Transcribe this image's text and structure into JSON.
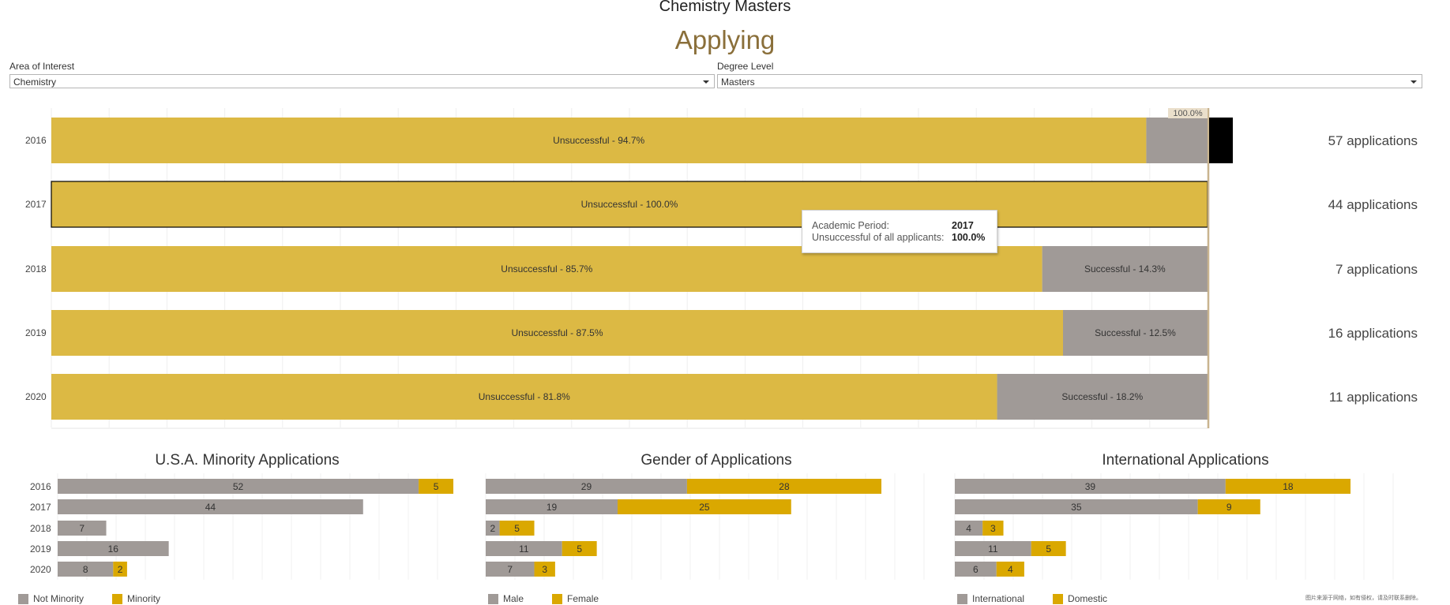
{
  "header": {
    "title": "Chemistry Masters",
    "subtitle": "Applying"
  },
  "filters": [
    {
      "label": "Area of Interest",
      "value": "Chemistry"
    },
    {
      "label": "Degree Level",
      "value": "Masters"
    }
  ],
  "colors": {
    "unsuccessful": "#dcb944",
    "successful": "#a09a97",
    "minority": "#daa800",
    "not_minority": "#a09a97",
    "selected_bar": "#000000",
    "accent": "#c9b48f"
  },
  "chart_data": [
    {
      "type": "bar",
      "orientation": "horizontal",
      "stacked": "percent",
      "categories": [
        "2016",
        "2017",
        "2018",
        "2019",
        "2020"
      ],
      "series": [
        {
          "name": "Unsuccessful",
          "values": [
            94.7,
            100.0,
            85.7,
            87.5,
            81.8
          ],
          "color": "#dcb944"
        },
        {
          "name": "Successful",
          "values": [
            5.3,
            0.0,
            14.3,
            12.5,
            18.2
          ],
          "color": "#a09a97"
        }
      ],
      "bar_labels": [
        [
          "Unsuccessful - 94.7%",
          ""
        ],
        [
          "Unsuccessful - 100.0%",
          ""
        ],
        [
          "Unsuccessful - 85.7%",
          "Successful - 14.3%"
        ],
        [
          "Unsuccessful - 87.5%",
          "Successful - 12.5%"
        ],
        [
          "Unsuccessful - 81.8%",
          "Successful - 18.2%"
        ]
      ],
      "reference_line": {
        "value": 100,
        "label": "100.0%"
      },
      "side_labels": [
        "57 applications",
        "44 applications",
        "7 applications",
        "16 applications",
        "11 applications"
      ],
      "selected_category": "2017",
      "xlim": [
        0,
        100
      ],
      "grid": true
    },
    {
      "type": "bar",
      "orientation": "horizontal",
      "stacked": true,
      "title": "U.S.A. Minority Applications",
      "categories": [
        "2016",
        "2017",
        "2018",
        "2019",
        "2020"
      ],
      "series": [
        {
          "name": "Not Minority",
          "values": [
            52,
            44,
            7,
            16,
            8
          ],
          "color": "#a09a97"
        },
        {
          "name": "Minority",
          "values": [
            5,
            0,
            0,
            0,
            2
          ],
          "color": "#daa800"
        }
      ],
      "xlim": [
        0,
        57
      ],
      "legend": "bottom-left"
    },
    {
      "type": "bar",
      "orientation": "horizontal",
      "stacked": true,
      "title": "Gender of Applications",
      "categories": [
        "2016",
        "2017",
        "2018",
        "2019",
        "2020"
      ],
      "series": [
        {
          "name": "Male",
          "values": [
            29,
            19,
            2,
            11,
            7
          ],
          "color": "#a09a97"
        },
        {
          "name": "Female",
          "values": [
            28,
            25,
            5,
            5,
            3
          ],
          "color": "#daa800"
        }
      ],
      "xlim": [
        0,
        57
      ],
      "legend": "bottom-left"
    },
    {
      "type": "bar",
      "orientation": "horizontal",
      "stacked": true,
      "title": "International Applications",
      "categories": [
        "2016",
        "2017",
        "2018",
        "2019",
        "2020"
      ],
      "series": [
        {
          "name": "International",
          "values": [
            39,
            35,
            4,
            11,
            6
          ],
          "color": "#a09a97"
        },
        {
          "name": "Domestic",
          "values": [
            18,
            9,
            3,
            5,
            4
          ],
          "color": "#daa800"
        }
      ],
      "xlim": [
        0,
        57
      ],
      "legend": "bottom-left"
    }
  ],
  "tooltip": {
    "rows": [
      {
        "key": "Academic Period:",
        "value": "2017"
      },
      {
        "key": "Unsuccessful of all applicants:",
        "value": "100.0%"
      }
    ]
  },
  "watermark": "图片来源于网络，如有侵权，请及时联系删除。"
}
